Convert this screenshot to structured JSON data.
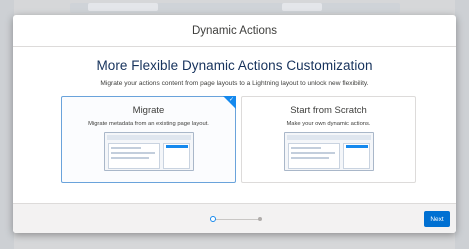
{
  "modal": {
    "title": "Dynamic Actions",
    "heading": "More Flexible Dynamic Actions Customization",
    "subheading": "Migrate your actions content from page layouts to a Lightning layout to unlock new flexibility.",
    "options": [
      {
        "title": "Migrate",
        "description": "Migrate metadata from an existing page layout.",
        "selected": true
      },
      {
        "title": "Start from Scratch",
        "description": "Make your own dynamic actions.",
        "selected": false
      }
    ],
    "progress": {
      "current_step": 1,
      "total_steps": 2
    },
    "next_label": "Next"
  },
  "colors": {
    "accent": "#1589ee",
    "button": "#0070d2",
    "heading": "#16325c"
  }
}
